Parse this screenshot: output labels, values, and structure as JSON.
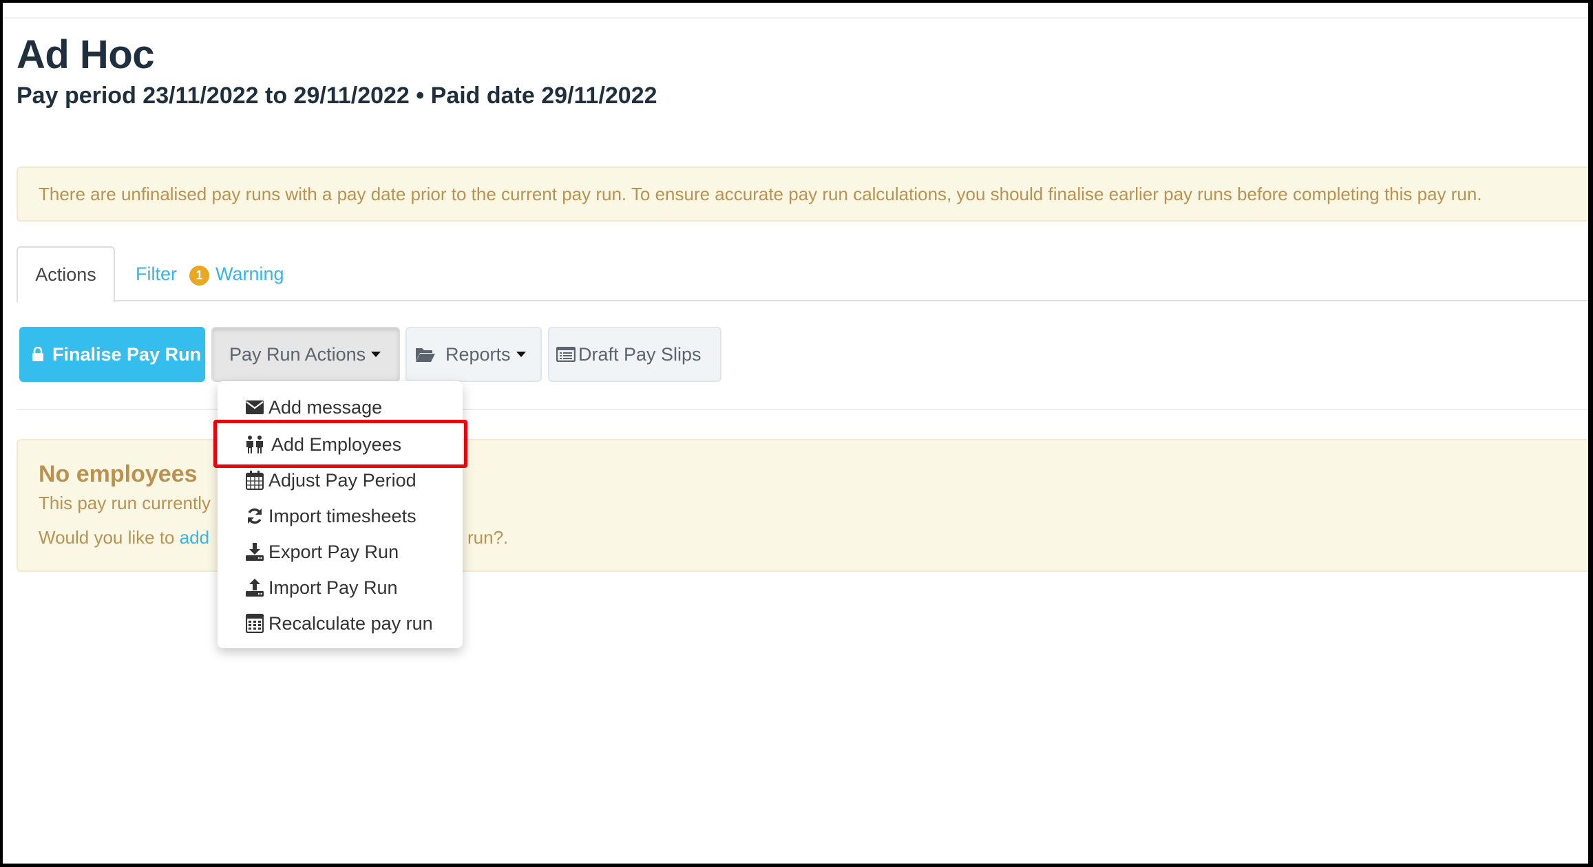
{
  "header": {
    "title": "Ad Hoc",
    "subtitle": "Pay period 23/11/2022 to 29/11/2022 • Paid date 29/11/2022"
  },
  "alert": {
    "text": "There are unfinalised pay runs with a pay date prior to the current pay run. To ensure accurate pay run calculations, you should finalise earlier pay runs before completing this pay run."
  },
  "tabs": [
    {
      "label": "Actions",
      "active": true
    },
    {
      "label": "Filter",
      "active": false
    },
    {
      "label": "Warning",
      "badge": "1",
      "active": false
    }
  ],
  "toolbar": {
    "finalise_label": "Finalise Pay Run",
    "pay_run_actions_label": "Pay Run Actions",
    "reports_label": "Reports",
    "draft_pay_slips_label": "Draft Pay Slips"
  },
  "dropdown": {
    "items": [
      {
        "label": "Add message",
        "icon": "envelope-icon"
      },
      {
        "label": "Add Employees",
        "icon": "users-icon",
        "highlighted": true
      },
      {
        "label": "Adjust Pay Period",
        "icon": "calendar-icon"
      },
      {
        "label": "Import timesheets",
        "icon": "refresh-icon"
      },
      {
        "label": "Export Pay Run",
        "icon": "download-icon"
      },
      {
        "label": "Import Pay Run",
        "icon": "upload-icon"
      },
      {
        "label": "Recalculate pay run",
        "icon": "calculator-icon"
      }
    ]
  },
  "empty_state": {
    "title": "No employees",
    "line1": "This pay run currently",
    "line2_prefix": "Would you like to ",
    "line2_link": "add",
    "line2_suffix": "run?."
  },
  "colors": {
    "primary": "#35bdee",
    "link": "#35b5e8",
    "warning_text": "#b99252",
    "warning_bg": "#fbf7e5",
    "badge": "#e9a724",
    "highlight": "#e8050d"
  }
}
